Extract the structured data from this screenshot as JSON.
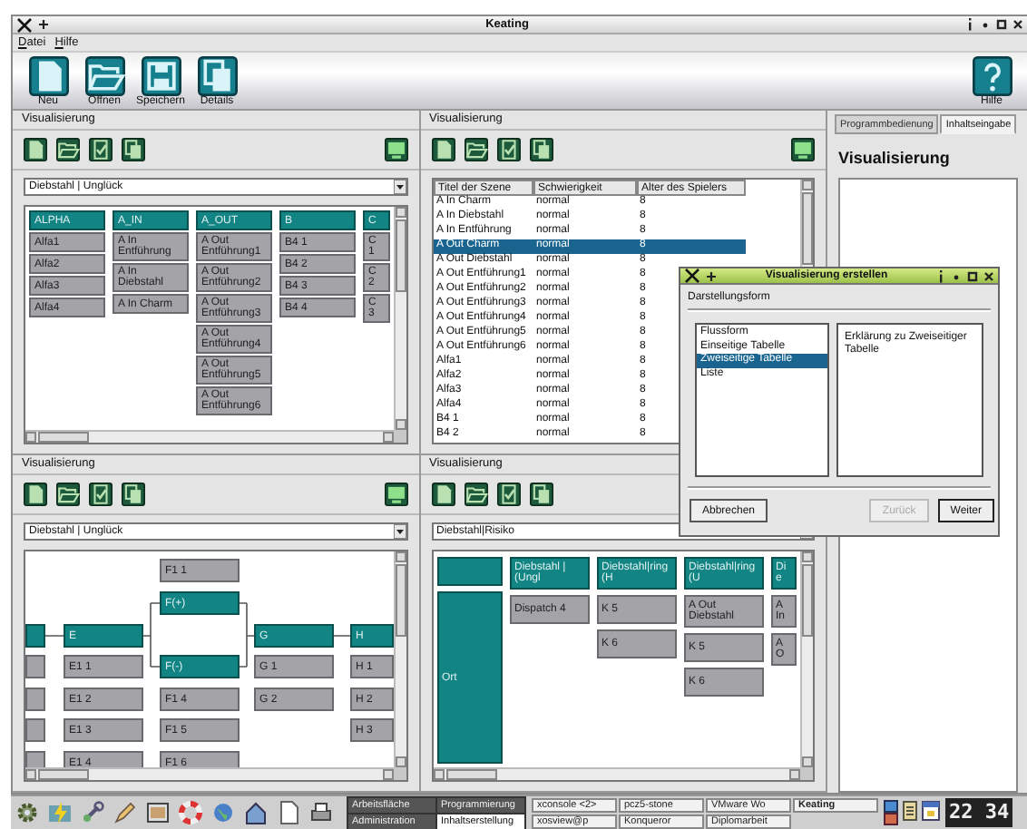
{
  "window": {
    "title": "Keating"
  },
  "menu": [
    "Datei",
    "Hilfe"
  ],
  "toolbar": [
    {
      "kind": "new",
      "label": "Neu"
    },
    {
      "kind": "open",
      "label": "Öffnen"
    },
    {
      "kind": "save",
      "label": "Speichern"
    },
    {
      "kind": "details",
      "label": "Details"
    }
  ],
  "help_button": {
    "label": "Hilfe"
  },
  "panels": [
    {
      "title": "Visualisierung",
      "screen_button": true,
      "combo": "Diebstahl | Unglück",
      "view": {
        "kind": "columns",
        "columns": [
          {
            "header": "ALPHA",
            "items": [
              "Alfa1",
              "Alfa2",
              "Alfa3",
              "Alfa4"
            ]
          },
          {
            "header": "A_IN",
            "items": [
              "A In Entführung",
              "A In Diebstahl",
              "A In Charm"
            ]
          },
          {
            "header": "A_OUT",
            "items": [
              "A Out Entführung1",
              "A Out Entführung2",
              "A Out Entführung3",
              "A Out Entführung4",
              "A Out Entführung5",
              "A Out Entführung6"
            ]
          },
          {
            "header": "B",
            "items": [
              "B4 1",
              "B4 2",
              "B4 3",
              "B4 4"
            ]
          },
          {
            "header": "C",
            "items": [
              "C 1",
              "C 2",
              "C 3"
            ]
          }
        ]
      }
    },
    {
      "title": "Visualisierung",
      "screen_button": true,
      "view": {
        "kind": "table",
        "columns": [
          "Titel der Szene",
          "Schwierigkeit",
          "Alter des Spielers"
        ],
        "rows": [
          {
            "cells": [
              "A In Charm",
              "normal",
              "8"
            ],
            "selected": false
          },
          {
            "cells": [
              "A In Diebstahl",
              "normal",
              "8"
            ],
            "selected": false
          },
          {
            "cells": [
              "A In Entführung",
              "normal",
              "8"
            ],
            "selected": false
          },
          {
            "cells": [
              "A Out Charm",
              "normal",
              "8"
            ],
            "selected": true
          },
          {
            "cells": [
              "A Out Diebstahl",
              "normal",
              "8"
            ],
            "selected": false
          },
          {
            "cells": [
              "A Out Entführung1",
              "normal",
              "8"
            ],
            "selected": false
          },
          {
            "cells": [
              "A Out Entführung2",
              "normal",
              "8"
            ],
            "selected": false
          },
          {
            "cells": [
              "A Out Entführung3",
              "normal",
              "8"
            ],
            "selected": false
          },
          {
            "cells": [
              "A Out Entführung4",
              "normal",
              "8"
            ],
            "selected": false
          },
          {
            "cells": [
              "A Out Entführung5",
              "normal",
              "8"
            ],
            "selected": false
          },
          {
            "cells": [
              "A Out Entführung6",
              "normal",
              "8"
            ],
            "selected": false
          },
          {
            "cells": [
              "Alfa1",
              "normal",
              "8"
            ],
            "selected": false
          },
          {
            "cells": [
              "Alfa2",
              "normal",
              "8"
            ],
            "selected": false
          },
          {
            "cells": [
              "Alfa3",
              "normal",
              "8"
            ],
            "selected": false
          },
          {
            "cells": [
              "Alfa4",
              "normal",
              "8"
            ],
            "selected": false
          },
          {
            "cells": [
              "B4 1",
              "normal",
              "8"
            ],
            "selected": false
          },
          {
            "cells": [
              "B4 2",
              "normal",
              "8"
            ],
            "selected": false
          }
        ]
      }
    },
    {
      "title": "Visualisierung",
      "screen_button": true,
      "combo": "Diebstahl | Unglück",
      "view": {
        "kind": "flow",
        "nodes": [
          {
            "kind": "item",
            "label": "F1 1"
          },
          {
            "kind": "header",
            "label": "F(+)"
          },
          {
            "kind": "header"
          },
          {
            "kind": "header",
            "label": "E"
          },
          {
            "kind": "header",
            "label": "G"
          },
          {
            "kind": "header",
            "label": "H"
          },
          {
            "kind": "item"
          },
          {
            "kind": "item",
            "label": "E1 1"
          },
          {
            "kind": "header",
            "label": "F(-)"
          },
          {
            "kind": "item",
            "label": "G 1"
          },
          {
            "kind": "item",
            "label": "H 1"
          },
          {
            "kind": "item"
          },
          {
            "kind": "item",
            "label": "E1 2"
          },
          {
            "kind": "item",
            "label": "F1 4"
          },
          {
            "kind": "item",
            "label": "G 2"
          },
          {
            "kind": "item",
            "label": "H 2"
          },
          {
            "kind": "item"
          },
          {
            "kind": "item",
            "label": "E1 3"
          },
          {
            "kind": "item",
            "label": "F1 5"
          },
          {
            "kind": "item",
            "label": "H 3"
          },
          {
            "kind": "item"
          },
          {
            "kind": "item",
            "label": "E1 4"
          },
          {
            "kind": "item",
            "label": "F1 6"
          }
        ]
      }
    },
    {
      "title": "Visualisierung",
      "combo": "Diebstahl|Risiko",
      "view": {
        "kind": "matrix",
        "row_header": "Ort",
        "columns": [
          {
            "header": "Diebstahl | (Ungl",
            "items": [
              "Dispatch 4"
            ]
          },
          {
            "header": "Diebstahl|ring (H",
            "items": [
              "K 5",
              "K 6"
            ]
          },
          {
            "header": "Diebstahl|ring (U",
            "items": [
              "A Out Diebstahl",
              "K 5",
              "K 6"
            ]
          },
          {
            "header": "Die",
            "items": [
              "A In",
              "A O"
            ]
          }
        ]
      }
    }
  ],
  "side": {
    "tabs": [
      {
        "label": "Programmbedienung",
        "selected": false
      },
      {
        "label": "Inhaltseingabe",
        "selected": true
      }
    ],
    "heading": "Visualisierung"
  },
  "dialog": {
    "title": "Visualisierung erstellen",
    "label": "Darstellungsform",
    "options": [
      {
        "label": "Flussform",
        "selected": false
      },
      {
        "label": "Einseitige Tabelle",
        "selected": false
      },
      {
        "label": "Zweiseitige Tabelle",
        "selected": true
      },
      {
        "label": "Liste",
        "selected": false
      }
    ],
    "description": "Erklärung zu Zweiseitiger Tabelle",
    "buttons": [
      {
        "kind": "cancel",
        "label": "Abbrechen",
        "disabled": false
      },
      {
        "kind": "back",
        "label": "Zurück",
        "disabled": true
      },
      {
        "kind": "next",
        "label": "Weiter",
        "disabled": false
      }
    ]
  },
  "taskbar": {
    "desktops": [
      {
        "label": "Arbeitsfläche",
        "selected": false
      },
      {
        "label": "Programmierung",
        "selected": false
      },
      {
        "label": "Administration",
        "selected": false
      },
      {
        "label": "Inhaltserstellung",
        "selected": true
      }
    ],
    "tasks": [
      {
        "label": "xconsole <2>",
        "selected": false
      },
      {
        "label": "pcz5-stone",
        "selected": false
      },
      {
        "label": "VMware Wo",
        "selected": false
      },
      {
        "label": "Keating",
        "selected": true
      },
      {
        "label": "xosview@p",
        "selected": false
      },
      {
        "label": "Konqueror",
        "selected": false
      },
      {
        "label": "Diplomarbeit",
        "selected": false
      }
    ],
    "clock": "22 34"
  }
}
